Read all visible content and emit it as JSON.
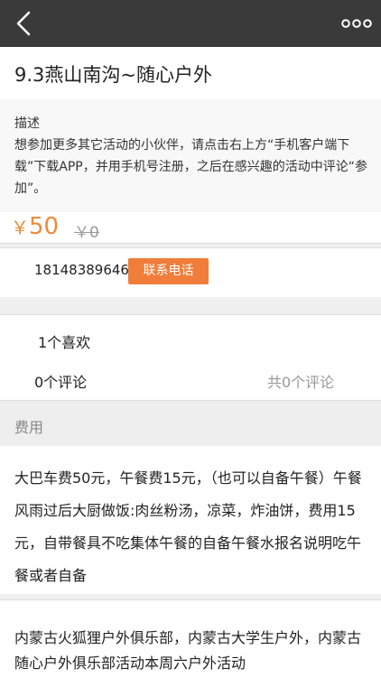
{
  "header": {
    "back_icon": "chevron-left-icon",
    "more_icon": "more-dots-icon"
  },
  "activity": {
    "title": "9.3燕山南沟~随心户外",
    "description_label": "描述",
    "description_text": "想参加更多其它活动的小伙伴，请点击右上方“手机客户端下载”下载APP，并用手机号注册，之后在感兴趣的活动中评论“参加”。",
    "price_symbol": "￥",
    "price": "50",
    "original_price": "￥0",
    "phone": "18148389646",
    "call_button_label": "联系电话",
    "likes": "1个喜欢",
    "comments": "0个评论",
    "comments_total": "共0个评论",
    "fee_label": "费用",
    "fee_text": "大巴车费50元，午餐费15元，（也可以自备午餐）午餐风雨过后大厨做饭:肉丝粉汤，凉菜，炸油饼，费用15元，自带餐具不吃集体午餐的自备午餐水报名说明吃午餐或者自备",
    "organizer_text": "内蒙古火狐狸户外俱乐部，内蒙古大学生户外，内蒙古随心户外俱乐部活动本周六户外活动"
  },
  "colors": {
    "navbar": "#3a3a3a",
    "accent": "#f07d3a",
    "price": "#f08a3a"
  }
}
